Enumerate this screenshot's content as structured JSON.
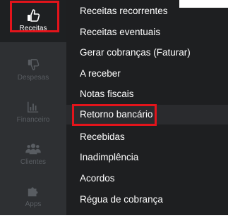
{
  "sidebar": {
    "items": [
      {
        "label": "Receitas",
        "icon": "thumbs-up-icon"
      },
      {
        "label": "Despesas",
        "icon": "thumbs-down-icon"
      },
      {
        "label": "Financeiro",
        "icon": "bar-chart-icon"
      },
      {
        "label": "Clientes",
        "icon": "users-icon"
      },
      {
        "label": "Apps",
        "icon": "puzzle-icon"
      }
    ]
  },
  "submenu": {
    "items": [
      {
        "label": "Receitas recorrentes"
      },
      {
        "label": "Receitas eventuais"
      },
      {
        "label": "Gerar cobranças (Faturar)"
      },
      {
        "label": "A receber"
      },
      {
        "label": "Notas fiscais"
      },
      {
        "label": "Retorno bancário"
      },
      {
        "label": "Recebidas"
      },
      {
        "label": "Inadimplência"
      },
      {
        "label": "Acordos"
      },
      {
        "label": "Régua de cobrança"
      }
    ]
  },
  "colors": {
    "sidebar_bg": "#2e3033",
    "menu_bg": "#1e1f21",
    "highlight_border": "#e3141b"
  }
}
